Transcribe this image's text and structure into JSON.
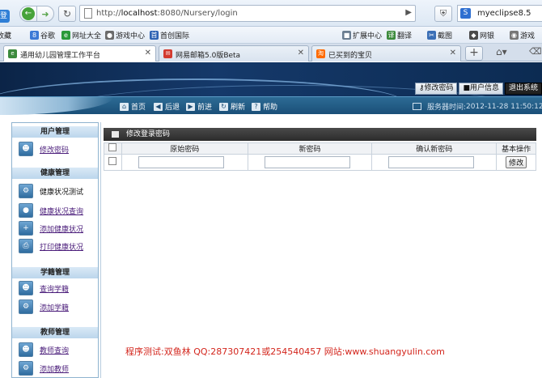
{
  "browser": {
    "login_pill": "登录",
    "url_scheme": "http://",
    "url_host": "localhost",
    "url_path": ":8080/Nursery/login",
    "search_text": "myeclipse8.5"
  },
  "favorites": [
    {
      "label": "收藏",
      "color": "#e8a01a"
    },
    {
      "label": "谷歌",
      "color": "#3b79d6"
    },
    {
      "label": "网址大全",
      "color": "#2a9a3a"
    },
    {
      "label": "游戏中心",
      "color": "#6b6b6b"
    },
    {
      "label": "首创国际",
      "color": "#2d62b3"
    },
    {
      "label": "扩展中心",
      "color": "#6a7d90"
    },
    {
      "label": "翻译",
      "color": "#3b8a3b"
    },
    {
      "label": "截图",
      "color": "#3b6fb6"
    },
    {
      "label": "网银",
      "color": "#4a4a4a"
    },
    {
      "label": "游戏",
      "color": "#777777"
    }
  ],
  "tabs": [
    {
      "label": "通用幼儿园管理工作平台",
      "color": "#3c8a3c"
    },
    {
      "label": "网易邮箱5.0版Beta",
      "color": "#d33a2f"
    },
    {
      "label": "已买到的宝贝",
      "color": "#ff6a00"
    }
  ],
  "header": {
    "links": [
      "修改密码",
      "用户信息",
      "退出系统"
    ]
  },
  "subnav": {
    "items": [
      "首页",
      "后退",
      "前进",
      "刷新",
      "帮助"
    ],
    "server_time_label": "服务器时间:",
    "server_time_value": "2012-11-28 11:50:12"
  },
  "sidebar": {
    "groups": [
      {
        "title": "用户管理",
        "items": [
          {
            "label": "修改密码",
            "link": true
          }
        ]
      },
      {
        "title": "健康管理",
        "items": [
          {
            "label": "健康状况测试",
            "link": false
          },
          {
            "label": "健康状况查询",
            "link": true
          },
          {
            "label": "添加健康状况",
            "link": true
          },
          {
            "label": "打印健康状况",
            "link": true
          }
        ]
      },
      {
        "title": "学籍管理",
        "items": [
          {
            "label": "查询学籍",
            "link": true
          },
          {
            "label": "添加学籍",
            "link": true
          }
        ]
      },
      {
        "title": "教师管理",
        "items": [
          {
            "label": "教师查询",
            "link": true
          },
          {
            "label": "添加教师",
            "link": true
          }
        ]
      }
    ]
  },
  "panel": {
    "title": "修改登录密码",
    "columns": [
      "原始密码",
      "新密码",
      "确认新密码",
      "基本操作"
    ],
    "edit_button": "修改"
  },
  "footer": {
    "note": "程序测试:双鱼林 QQ:287307421或254540457  网站:www.shuangyulin.com"
  }
}
